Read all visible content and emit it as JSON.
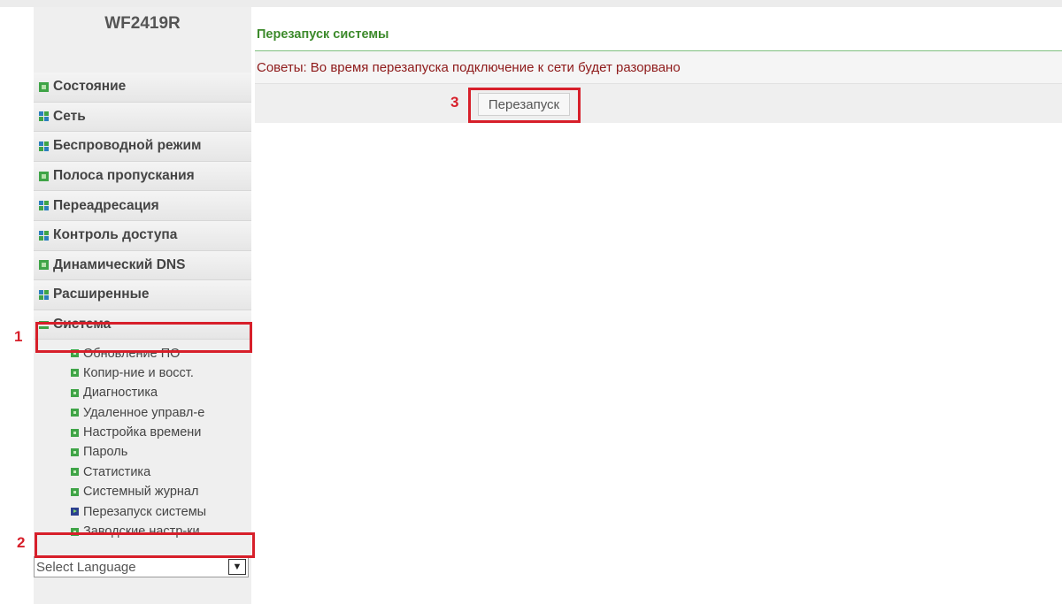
{
  "brand": "WF2419R",
  "menu": [
    {
      "label": "Состояние",
      "icon": "green-square-icon"
    },
    {
      "label": "Сеть",
      "icon": "grid-icon"
    },
    {
      "label": "Беспроводной режим",
      "icon": "grid-icon"
    },
    {
      "label": "Полоса пропускания",
      "icon": "green-square-icon"
    },
    {
      "label": "Переадресация",
      "icon": "grid-icon"
    },
    {
      "label": "Контроль доступа",
      "icon": "grid-icon"
    },
    {
      "label": "Динамический DNS",
      "icon": "green-square-icon"
    },
    {
      "label": "Расширенные",
      "icon": "grid-icon"
    },
    {
      "label": "Система",
      "icon": "expanded-bars-icon",
      "expanded": true
    }
  ],
  "submenu": [
    {
      "label": "Обновление ПО"
    },
    {
      "label": "Копир-ние и восст."
    },
    {
      "label": "Диагностика"
    },
    {
      "label": "Удаленное управл-е"
    },
    {
      "label": "Настройка времени"
    },
    {
      "label": "Пароль"
    },
    {
      "label": "Статистика"
    },
    {
      "label": "Системный журнал"
    },
    {
      "label": "Перезапуск системы",
      "active": true
    },
    {
      "label": "Заводские настр-ки"
    }
  ],
  "language": {
    "selected": "Select Language"
  },
  "main": {
    "title": "Перезапуск системы",
    "hint": "Советы: Во время перезапуска подключение к сети будет разорвано",
    "button_label": "Перезапуск"
  },
  "annotations": [
    {
      "number": "1",
      "target": "Система"
    },
    {
      "number": "2",
      "target": "Перезапуск системы"
    },
    {
      "number": "3",
      "target": "Перезапуск"
    }
  ],
  "colors": {
    "accent_green": "#3c8a2b",
    "hint_text": "#8e1a1a",
    "annotation_red": "#d71f2a"
  }
}
